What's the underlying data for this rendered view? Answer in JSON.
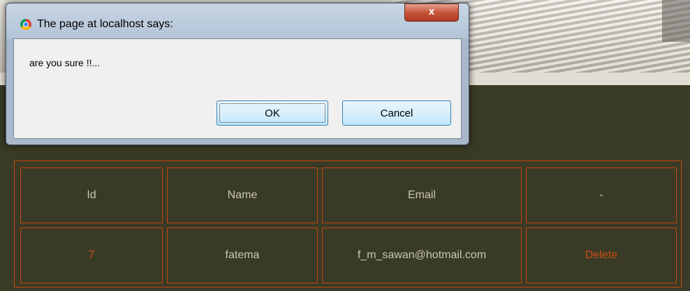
{
  "dialog": {
    "title": "The page at localhost says:",
    "close_label": "x",
    "message": "are you sure !!...",
    "ok_label": "OK",
    "cancel_label": "Cancel"
  },
  "table": {
    "headers": [
      "Id",
      "Name",
      "Email",
      "-"
    ],
    "rows": [
      {
        "id": "7",
        "name": "fatema",
        "email": "f_m_sawan@hotmail.com",
        "action": "Delete"
      }
    ]
  },
  "colors": {
    "page_background": "#3a3b26",
    "table_border": "#c4470f",
    "accent_text": "#cd4b12",
    "header_text": "#c8c7b8"
  },
  "icons": {
    "dialog_icon": "chrome-icon",
    "close": "close-icon"
  }
}
